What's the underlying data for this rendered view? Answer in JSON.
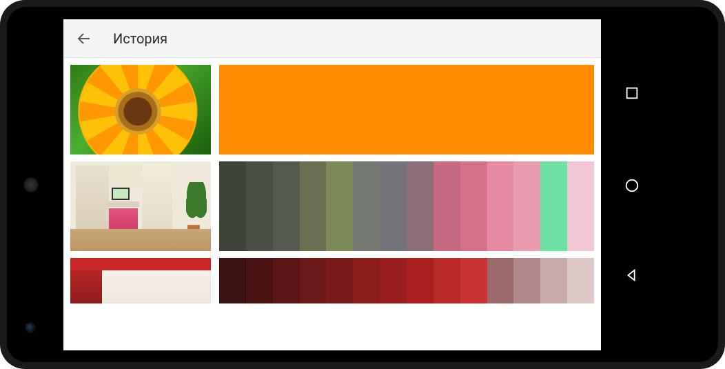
{
  "header": {
    "title": "История",
    "back_icon": "arrow-left"
  },
  "system_nav": {
    "recent": "square",
    "home": "circle",
    "back": "triangle-left"
  },
  "history": [
    {
      "thumb": "flower",
      "palette": [
        "#ff8c00"
      ]
    },
    {
      "thumb": "room-desk",
      "palette": [
        "#3f4438",
        "#4a4f43",
        "#555a4e",
        "#6a6f52",
        "#7c8a5a",
        "#747a72",
        "#74737a",
        "#8b6f77",
        "#c56a82",
        "#d6718b",
        "#e58aa2",
        "#e89aaf",
        "#6ee0a3",
        "#f2c7d4"
      ]
    },
    {
      "thumb": "room-red",
      "palette": [
        "#3a1212",
        "#4a1414",
        "#5a1616",
        "#6a1818",
        "#7a1a1a",
        "#8a1c1c",
        "#9a1e1e",
        "#aa2020",
        "#ba2a2a",
        "#c83434",
        "#9a6a6a",
        "#b08a8a",
        "#c8aaaa",
        "#ddc8c8"
      ]
    }
  ]
}
